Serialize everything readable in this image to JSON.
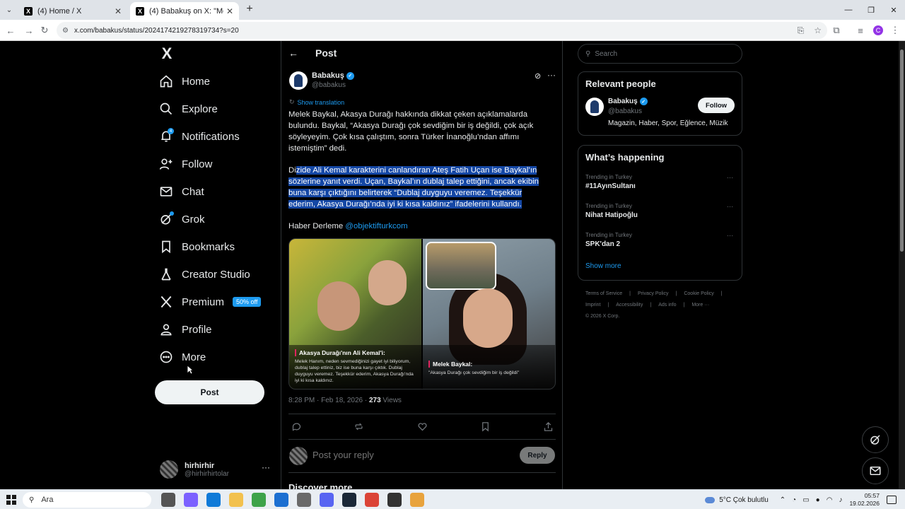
{
  "browser": {
    "tabs": [
      {
        "title": "(4) Home / X",
        "favicon": "X"
      },
      {
        "title": "(4) Babakuş on X: \"Melek Bayka",
        "favicon": "X"
      }
    ],
    "new_tab_icon": "plus-icon",
    "url": "x.com/babakus/status/2024174219278319734?s=20",
    "profile_initial": "C"
  },
  "x_logo": "X",
  "nav": {
    "items": [
      {
        "label": "Home",
        "icon": "home-icon"
      },
      {
        "label": "Explore",
        "icon": "search-icon"
      },
      {
        "label": "Notifications",
        "icon": "bell-icon",
        "badge": "4"
      },
      {
        "label": "Follow",
        "icon": "person-plus-icon"
      },
      {
        "label": "Chat",
        "icon": "mail-icon"
      },
      {
        "label": "Grok",
        "icon": "grok-icon"
      },
      {
        "label": "Bookmarks",
        "icon": "bookmark-icon"
      },
      {
        "label": "Creator Studio",
        "icon": "flask-icon"
      },
      {
        "label": "Premium",
        "icon": "x-icon",
        "promo": "50% off"
      },
      {
        "label": "Profile",
        "icon": "person-icon"
      },
      {
        "label": "More",
        "icon": "more-circle-icon"
      }
    ],
    "post_button": "Post"
  },
  "account": {
    "name": "hirhirhir",
    "handle": "@hirhirhirtolar"
  },
  "post_view": {
    "header": "Post",
    "author": {
      "name": "Babakuş",
      "handle": "@babakus"
    },
    "show_translation": "Show translation",
    "paragraph1": "Melek Baykal, Akasya Durağı hakkında dikkat çeken açıklamalarda bulundu. Baykal, “Akasya Durağı çok sevdiğim bir iş değildi, çok açık söyleyeyim. Çok kısa çalıştım, sonra Türker İnanoğlu’ndan affımı istemiştim” dedi.",
    "paragraph2_lead": "Di",
    "paragraph2_selected": "zide Ali Kemal karakterini canlandıran Ateş Fatih Uçan ise Baykal’ın sözlerine yanıt verdi. Uçan, Baykal’ın dublaj talep ettiğini, ancak ekibin buna karşı çıktığını belirterek “Dublaj duyguyu veremez. Teşekkür ederim, Akasya Durağı’nda iyi ki kısa kaldınız” ifadelerini kullandı.",
    "paragraph3_text": "Haber Derleme ",
    "paragraph3_mention": "@objektifturkcom",
    "media": {
      "left_caption_title": "Akasya Durağı'nın Ali Kemal'i:",
      "left_caption_text": "Melek Hanım, neden sevmediğinizi gayet iyi biliyorum, dublaj talep ettiniz, biz ise buna karşı çıktık. Dublaj duyguyu veremez. Teşekkür ederim, Akasya Durağı'nda iyi ki kısa kaldınız.",
      "right_caption_title": "Melek Baykal:",
      "right_caption_text": "\"Akasya Durağı çok sevdiğim bir iş değildi\""
    },
    "time": "8:28 PM · Feb 18, 2026 · ",
    "views_count": "273",
    "views_label": " Views",
    "reply_placeholder": "Post your reply",
    "reply_button": "Reply",
    "discover_more": "Discover more"
  },
  "sidebar": {
    "search_placeholder": "Search",
    "relevant_title": "Relevant people",
    "relevant": {
      "name": "Babakuş",
      "handle": "@babakus",
      "bio": "Magazin, Haber, Spor, Eğlence, Müzik",
      "follow": "Follow"
    },
    "happening_title": "What’s happening",
    "trends": [
      {
        "context": "Trending in Turkey",
        "name": "#11AyınSultanı"
      },
      {
        "context": "Trending in Turkey",
        "name": "Nihat Hatipoğlu"
      },
      {
        "context": "Trending in Turkey",
        "name": "SPK'dan 2"
      }
    ],
    "show_more": "Show more",
    "footer": {
      "line1": [
        "Terms of Service",
        "|",
        "Privacy Policy",
        "|",
        "Cookie Policy",
        "|"
      ],
      "line2": [
        "Imprint",
        "|",
        "Accessibility",
        "|",
        "Ads info",
        "|",
        "More ···"
      ],
      "copyright": "© 2026 X Corp."
    }
  },
  "taskbar": {
    "search_text": "Ara",
    "weather": "5°C  Çok bulutlu",
    "time": "05:57",
    "date": "19.02.2026"
  },
  "colors": {
    "accent": "#1d9bf0",
    "selection": "#1447a5",
    "background": "#000000"
  }
}
